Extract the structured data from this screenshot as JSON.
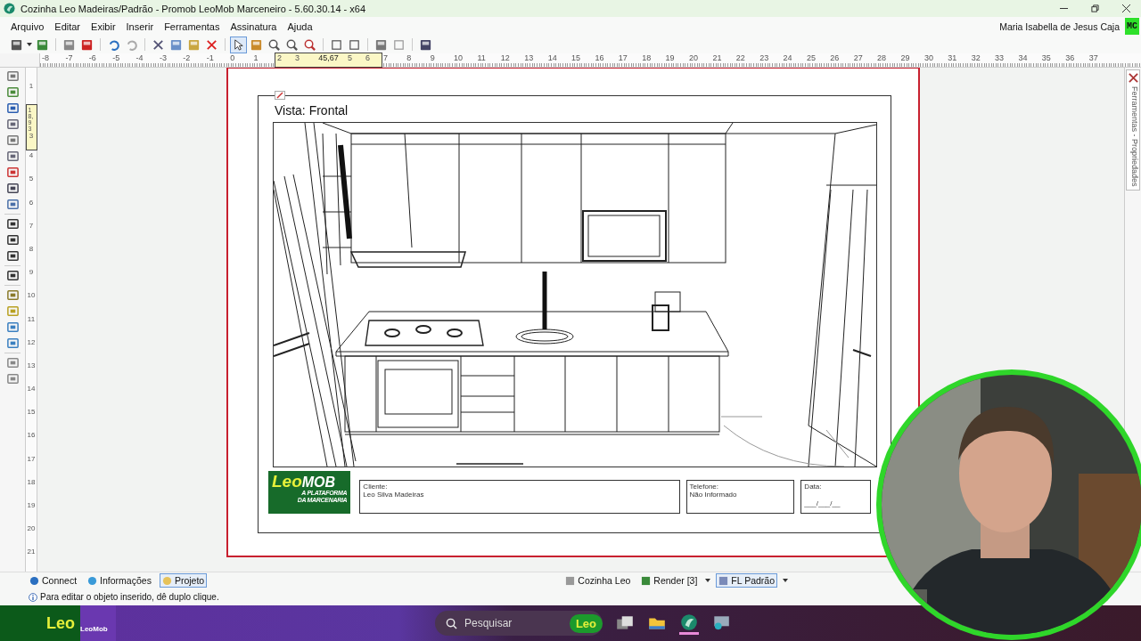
{
  "window": {
    "title": "Cozinha Leo Madeiras/Padrão - Promob LeoMob Marceneiro - 5.60.30.14 - x64"
  },
  "menu": [
    "Arquivo",
    "Editar",
    "Exibir",
    "Inserir",
    "Ferramentas",
    "Assinatura",
    "Ajuda"
  ],
  "user": {
    "name": "Maria Isabella de Jesus Caja",
    "initials": "MC"
  },
  "rulers": {
    "horizontal": {
      "labels": [
        "-8",
        "-7",
        "-6",
        "-5",
        "-4",
        "-3",
        "-2",
        "-1",
        "0",
        "1"
      ],
      "selection": {
        "labels": [
          "2",
          "3",
          "5",
          "6"
        ],
        "reading": "45,67"
      },
      "labels_after": [
        "7",
        "8",
        "9",
        "10",
        "11",
        "12",
        "13",
        "14",
        "15",
        "16",
        "17",
        "18",
        "19",
        "20",
        "21",
        "22",
        "23",
        "24",
        "25",
        "26",
        "27",
        "28",
        "29",
        "30",
        "31",
        "32",
        "33",
        "34",
        "35",
        "36",
        "37"
      ]
    },
    "vertical": {
      "labels": [
        "1"
      ],
      "selection": {
        "labels": [
          "3"
        ],
        "reading": "18,93"
      },
      "labels_after": [
        "4",
        "5",
        "6",
        "7",
        "8",
        "9",
        "10",
        "11",
        "12",
        "13",
        "14",
        "15",
        "16",
        "17",
        "18",
        "19",
        "20",
        "21"
      ]
    }
  },
  "side_panel": {
    "title": "Ferramentas - Propriedades"
  },
  "page": {
    "view_title": "Vista: Frontal",
    "logo": {
      "part_1": "Leo",
      "part_2": "MOB",
      "tagline": [
        "A PLATAFORMA",
        "DA MARCENARIA"
      ]
    },
    "fields": [
      {
        "label": "Cliente:",
        "value": "Leo Silva Madeiras"
      },
      {
        "label": "Telefone:",
        "value": "Não Informado"
      },
      {
        "label": "Data:",
        "value": "___/___/__"
      }
    ]
  },
  "bottom_tabs_left": [
    {
      "label": "Connect",
      "selected": false
    },
    {
      "label": "Informações",
      "selected": false
    },
    {
      "label": "Projeto",
      "selected": true
    }
  ],
  "bottom_tabs_right": [
    {
      "label": "Cozinha Leo",
      "selected": false,
      "dropdown": false
    },
    {
      "label": "Render [3]",
      "selected": false,
      "dropdown": true
    },
    {
      "label": "FL Padrão",
      "selected": true,
      "dropdown": true
    }
  ],
  "status": "Para editar o objeto inserido, dê duplo clique.",
  "taskbar": {
    "brand": "Leo",
    "brand_sub": "LeoMob",
    "search_placeholder": "Pesquisar",
    "app_badge": "Leo"
  }
}
